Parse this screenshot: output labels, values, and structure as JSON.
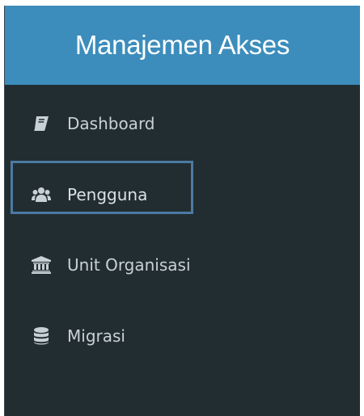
{
  "header": {
    "title": "Manajemen Akses"
  },
  "menu": {
    "items": [
      {
        "label": "Dashboard",
        "icon": "book-icon"
      },
      {
        "label": "Pengguna",
        "icon": "users-icon"
      },
      {
        "label": "Unit Organisasi",
        "icon": "institution-icon"
      },
      {
        "label": "Migrasi",
        "icon": "database-icon"
      }
    ],
    "highlighted_item": "Pengguna"
  },
  "colors": {
    "header_bg": "#3c8dbc",
    "sidebar_bg": "#222d32",
    "menu_text": "#c8d1d6",
    "highlight_border": "#4d7aa3"
  }
}
